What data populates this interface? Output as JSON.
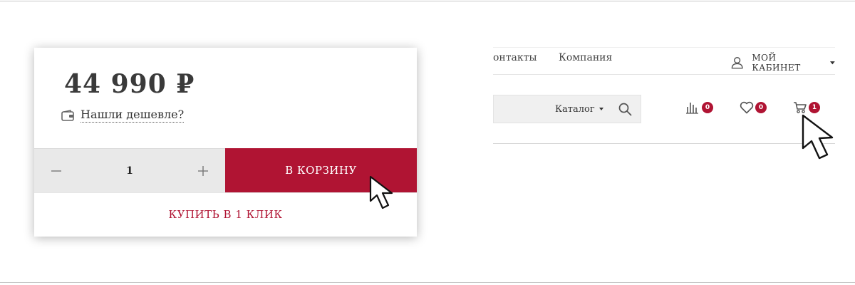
{
  "product": {
    "price": "44 990 ₽",
    "cheaper_link": "Нашли дешевле?",
    "quantity": "1",
    "add_to_cart": "В КОРЗИНУ",
    "buy_one_click": "КУПИТЬ В 1 КЛИК"
  },
  "header": {
    "nav": {
      "contacts": "онтакты",
      "company": "Компания"
    },
    "account": {
      "label": "МОЙ КАБИНЕТ"
    },
    "search": {
      "catalog_label": "Каталог"
    },
    "counters": {
      "compare": "0",
      "favorites": "0",
      "cart": "1"
    }
  },
  "colors": {
    "accent": "#b01433",
    "quantity_bg": "#e9e9e9",
    "search_bg": "#f0f0f0"
  },
  "icons": [
    "wallet-icon",
    "minus-icon",
    "plus-icon",
    "user-icon",
    "chevron-down-icon",
    "search-icon",
    "compare-icon",
    "heart-icon",
    "cart-icon",
    "mouse-cursor-icon"
  ]
}
